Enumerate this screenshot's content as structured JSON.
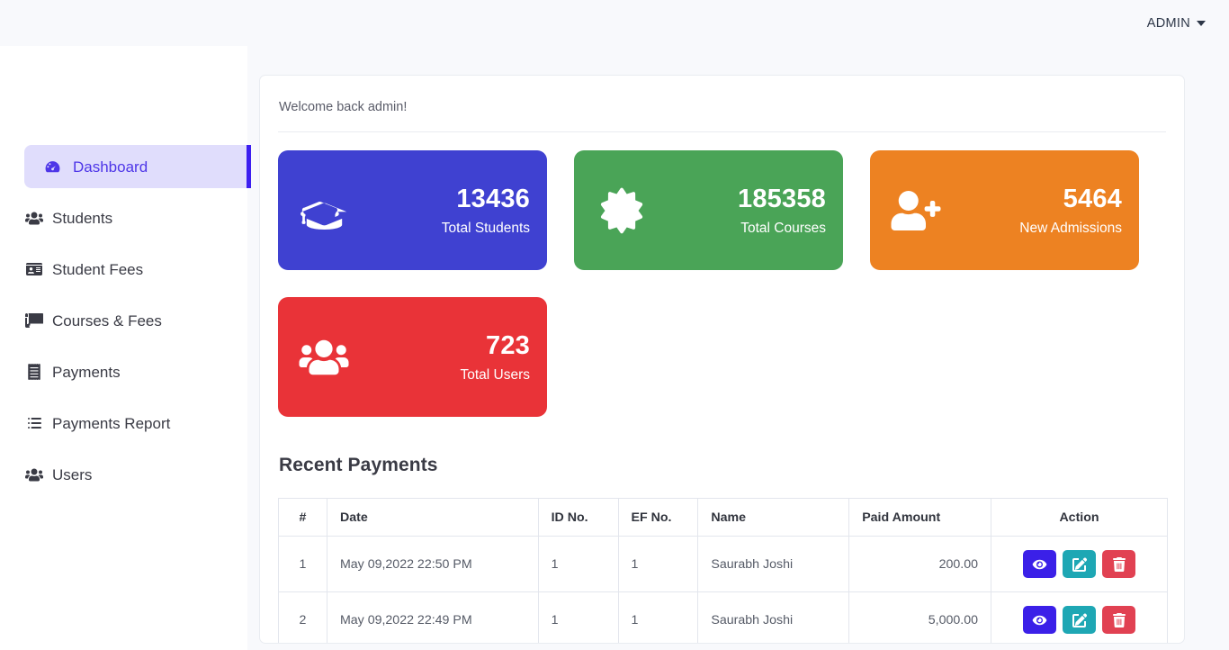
{
  "topbar": {
    "admin_label": "ADMIN"
  },
  "sidebar": {
    "items": [
      {
        "label": "Dashboard",
        "icon": "dashboard-icon",
        "active": true
      },
      {
        "label": "Students",
        "icon": "users-icon",
        "active": false
      },
      {
        "label": "Student Fees",
        "icon": "id-card-icon",
        "active": false
      },
      {
        "label": "Courses & Fees",
        "icon": "scroll-icon",
        "active": false
      },
      {
        "label": "Payments",
        "icon": "receipt-icon",
        "active": false
      },
      {
        "label": "Payments Report",
        "icon": "list-icon",
        "active": false
      },
      {
        "label": "Users",
        "icon": "users-icon",
        "active": false
      }
    ]
  },
  "main": {
    "welcome": "Welcome back admin!",
    "stats": [
      {
        "value": "13436",
        "label": "Total Students",
        "color": "#3f41d1",
        "icon": "graduation-cap-icon"
      },
      {
        "value": "185358",
        "label": "Total Courses",
        "color": "#4aa css",
        "icon": "certificate-icon"
      },
      {
        "value": "5464",
        "label": "New Admissions",
        "color": "#ed8222",
        "icon": "user-plus-icon"
      },
      {
        "value": "723",
        "label": "Total Users",
        "color": "#e93338",
        "icon": "users-group-icon"
      }
    ],
    "section_title": "Recent Payments",
    "table": {
      "columns": [
        "#",
        "Date",
        "ID No.",
        "EF No.",
        "Name",
        "Paid Amount",
        "Action"
      ],
      "rows": [
        {
          "num": "1",
          "date": "May 09,2022 22:50 PM",
          "id_no": "1",
          "ef_no": "1",
          "name": "Saurabh Joshi",
          "amount": "200.00"
        },
        {
          "num": "2",
          "date": "May 09,2022 22:49 PM",
          "id_no": "1",
          "ef_no": "1",
          "name": "Saurabh Joshi",
          "amount": "5,000.00"
        }
      ],
      "actions": [
        {
          "name": "view",
          "icon": "eye-icon",
          "color": "#3b20e8"
        },
        {
          "name": "edit",
          "icon": "edit-icon",
          "color": "#1ea7b4"
        },
        {
          "name": "delete",
          "icon": "trash-icon",
          "color": "#e14152"
        }
      ]
    }
  },
  "colors": {
    "page_background": "#f8f9fc",
    "sidebar_background": "#ffffff",
    "active_nav_background": "#e0ddfc",
    "active_nav_text": "#4e36e8",
    "active_nav_bar": "#3c1ef0",
    "card_blue": "#3f41d1",
    "card_green": "#4aa css",
    "card_orange": "#ed8222",
    "card_red": "#e93338"
  }
}
